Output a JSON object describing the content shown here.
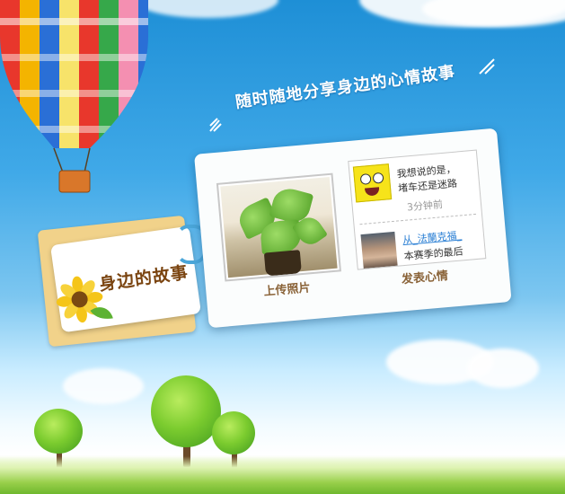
{
  "slogan": "随时随地分享身边的心情故事",
  "tag": {
    "title": "身边的故事"
  },
  "card": {
    "upload_label": "上传照片",
    "post_label": "发表心情",
    "mood": {
      "line1": "我想说的是，",
      "line2": "堵车还是迷路",
      "time": "3分钟前",
      "user": "从_法蘭克福_",
      "line3": "本赛季的最后"
    }
  },
  "colors": {
    "sky": "#40a9e8",
    "label": "#8a6338",
    "link": "#2a7fd4",
    "tag_text": "#7a4410"
  }
}
